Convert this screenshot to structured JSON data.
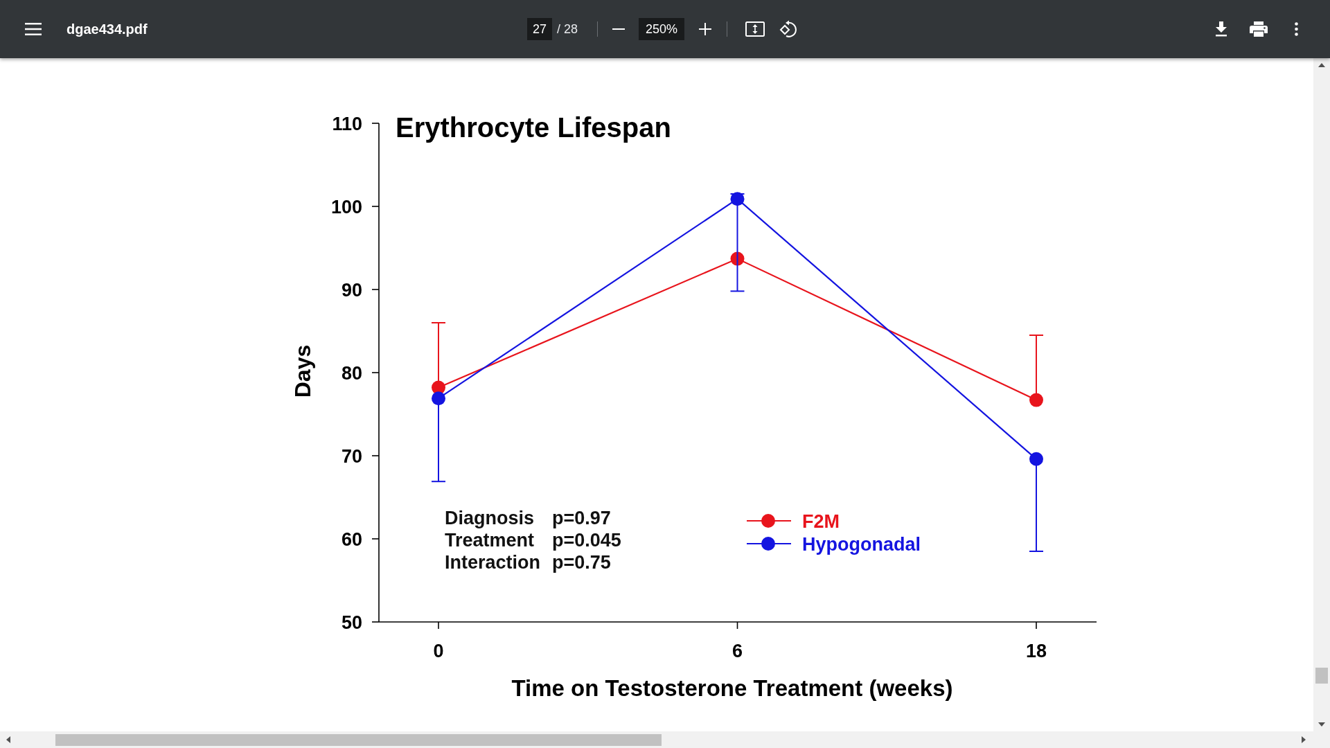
{
  "toolbar": {
    "file_name": "dgae434.pdf",
    "page_number": "27",
    "page_total": "/ 28",
    "zoom": "250%"
  },
  "document": {
    "chart_data": {
      "type": "line",
      "title": "Erythrocyte Lifespan",
      "xlabel": "Time on Testosterone Treatment (weeks)",
      "ylabel": "Days",
      "categories": [
        "0",
        "6",
        "18"
      ],
      "ylim": [
        50,
        110
      ],
      "yticks": [
        50,
        60,
        70,
        80,
        90,
        100,
        110
      ],
      "series": [
        {
          "name": "F2M",
          "color": "#e8141c",
          "marker": "o",
          "values": [
            78.2,
            93.7,
            76.7
          ],
          "errors": [
            [
              78.2,
              86.0
            ],
            null,
            [
              76.7,
              84.5
            ]
          ]
        },
        {
          "name": "Hypogonadal",
          "color": "#1414e0",
          "marker": "o",
          "values": [
            76.9,
            100.9,
            69.6
          ],
          "errors": [
            [
              66.9,
              76.9
            ],
            [
              89.8,
              101.5
            ],
            [
              58.5,
              69.6
            ]
          ]
        }
      ],
      "legend": true,
      "annotations": [
        "Diagnosis",
        "p=0.97",
        "Treatment",
        "p=0.045",
        "Interaction",
        "p=0.75"
      ]
    }
  }
}
